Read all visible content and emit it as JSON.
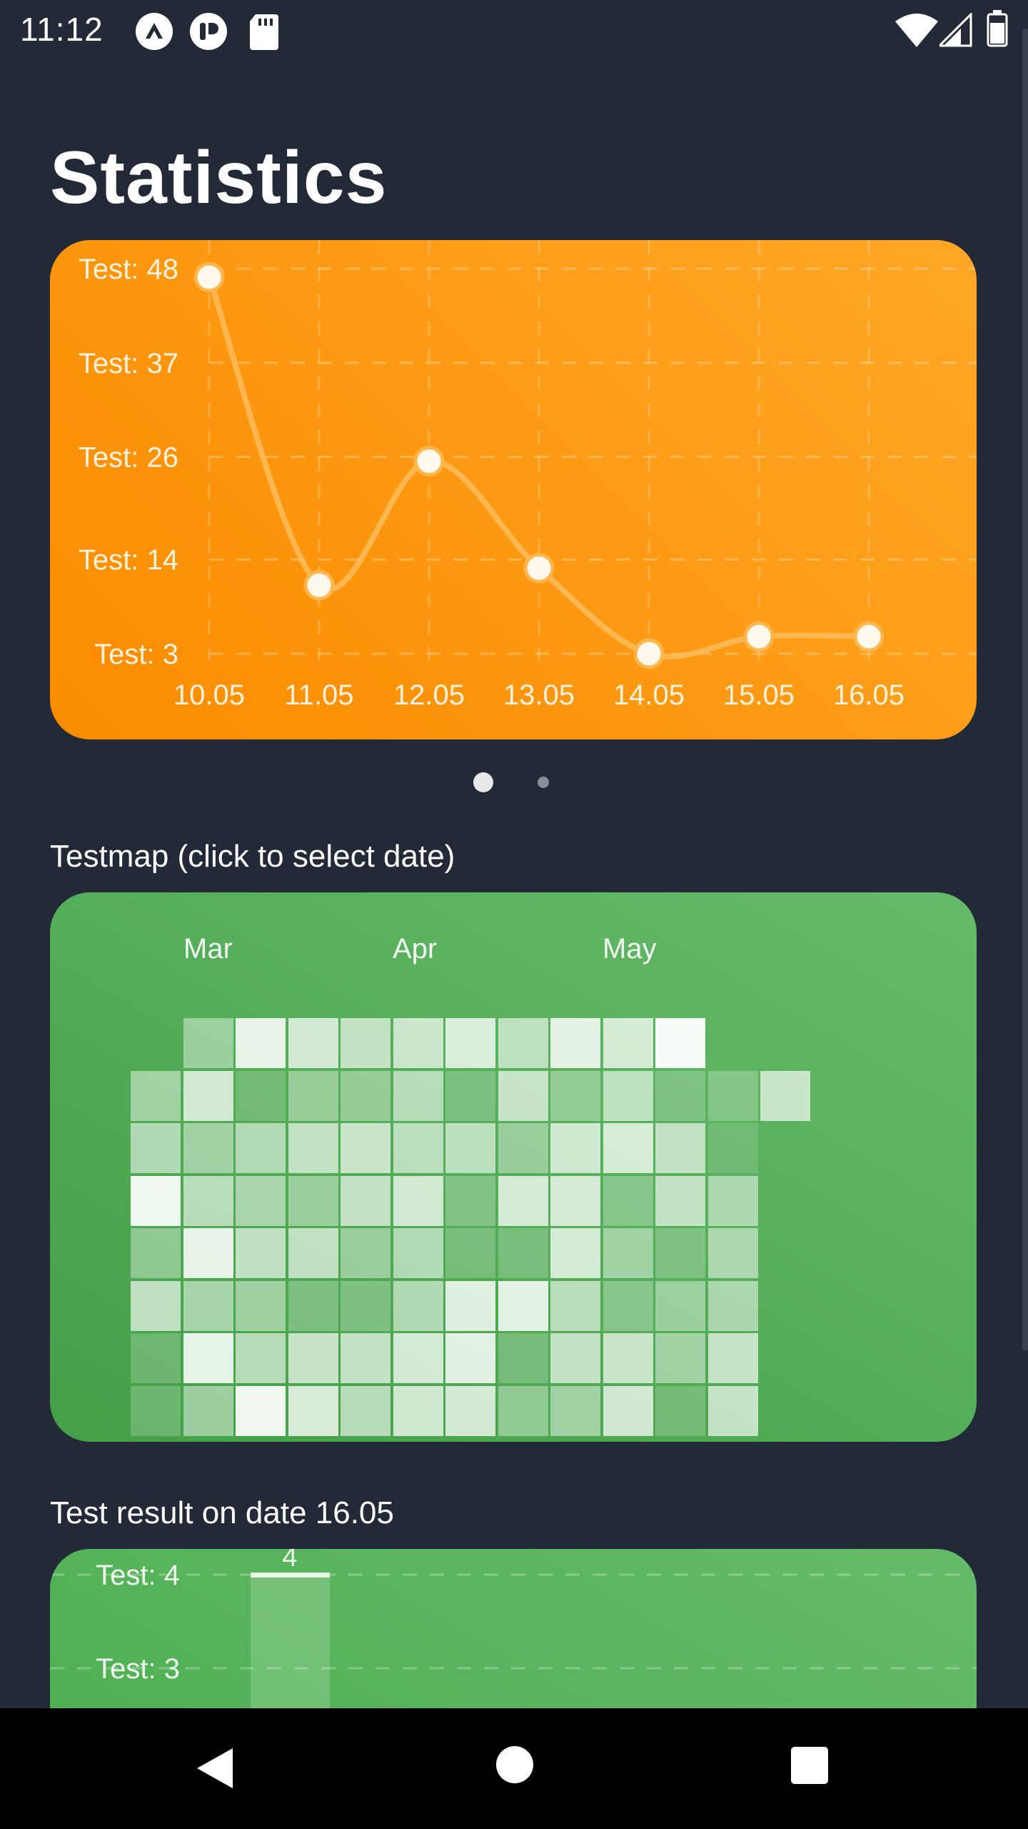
{
  "status_bar": {
    "time": "11:12",
    "icons": [
      "app-notification-icon",
      "app-notification-icon-2",
      "sd-card-icon",
      "wifi-icon",
      "cell-signal-icon",
      "battery-icon"
    ]
  },
  "page": {
    "title": "Statistics"
  },
  "line_chart": {
    "chart_data": {
      "type": "line",
      "x": [
        "10.05",
        "11.05",
        "12.05",
        "13.05",
        "14.05",
        "15.05",
        "16.05"
      ],
      "values": [
        47,
        11,
        25.5,
        13,
        3,
        5,
        5
      ],
      "y_ticks": [
        "Test: 48",
        "Test: 37",
        "Test: 26",
        "Test: 14",
        "Test: 3"
      ],
      "y_tick_values": [
        48,
        37,
        26,
        14,
        3
      ],
      "ylim": [
        3,
        48
      ],
      "grid": true,
      "colors": {
        "background_start": "#fb8c00",
        "background_end": "#ffa726",
        "line": "#ffc266",
        "point": "#fff8ec"
      }
    }
  },
  "pager": {
    "pages": 2,
    "active": 0
  },
  "heatmap": {
    "label": "Testmap (click to select date)",
    "months": [
      "Mar",
      "Apr",
      "May"
    ],
    "weeks": 13,
    "intensity": [
      [
        null,
        0.4,
        0.5,
        0.9,
        0.3,
        0.6,
        0.1,
        0.1
      ],
      [
        0.35,
        0.7,
        0.4,
        0.55,
        0.85,
        0.45,
        0.85,
        0.4
      ],
      [
        0.85,
        0.08,
        0.5,
        0.45,
        0.6,
        0.4,
        0.55,
        0.9
      ],
      [
        0.7,
        0.32,
        0.6,
        0.35,
        0.6,
        0.18,
        0.65,
        0.75
      ],
      [
        0.6,
        0.3,
        0.65,
        0.6,
        0.35,
        0.18,
        0.62,
        0.55
      ],
      [
        0.65,
        0.52,
        0.55,
        0.7,
        0.5,
        0.5,
        0.72,
        0.7
      ],
      [
        0.75,
        0.12,
        0.55,
        0.18,
        0.12,
        0.8,
        0.82,
        0.72
      ],
      [
        0.55,
        0.62,
        0.32,
        0.72,
        0.12,
        0.82,
        0.12,
        0.3
      ],
      [
        0.82,
        0.28,
        0.68,
        0.72,
        0.72,
        0.55,
        0.62,
        0.4
      ],
      [
        0.7,
        0.55,
        0.72,
        0.2,
        0.38,
        0.22,
        0.65,
        0.7
      ],
      [
        0.95,
        0.12,
        0.58,
        0.6,
        0.15,
        0.35,
        0.38,
        0.1
      ],
      [
        null,
        0.15,
        0.02,
        0.45,
        0.45,
        0.45,
        0.62,
        0.62
      ],
      [
        null,
        0.62,
        null,
        null,
        null,
        null,
        null,
        null
      ]
    ],
    "colors": {
      "base": "#ffffff",
      "background_start": "#43a047",
      "background_end": "#66bb6a"
    }
  },
  "result": {
    "label": "Test result on date 16.05",
    "chart_data": {
      "type": "bar",
      "categories": [
        ""
      ],
      "values": [
        4
      ],
      "data_labels": [
        "4"
      ],
      "y_ticks": [
        "Test: 4",
        "Test: 3"
      ],
      "y_tick_values": [
        4,
        3
      ],
      "grid": true,
      "colors": {
        "bar": "#7fc383",
        "bar_top": "#e8f5e9"
      }
    }
  },
  "nav_bar": {
    "back": "back-icon",
    "home": "home-icon",
    "recents": "recents-icon"
  }
}
